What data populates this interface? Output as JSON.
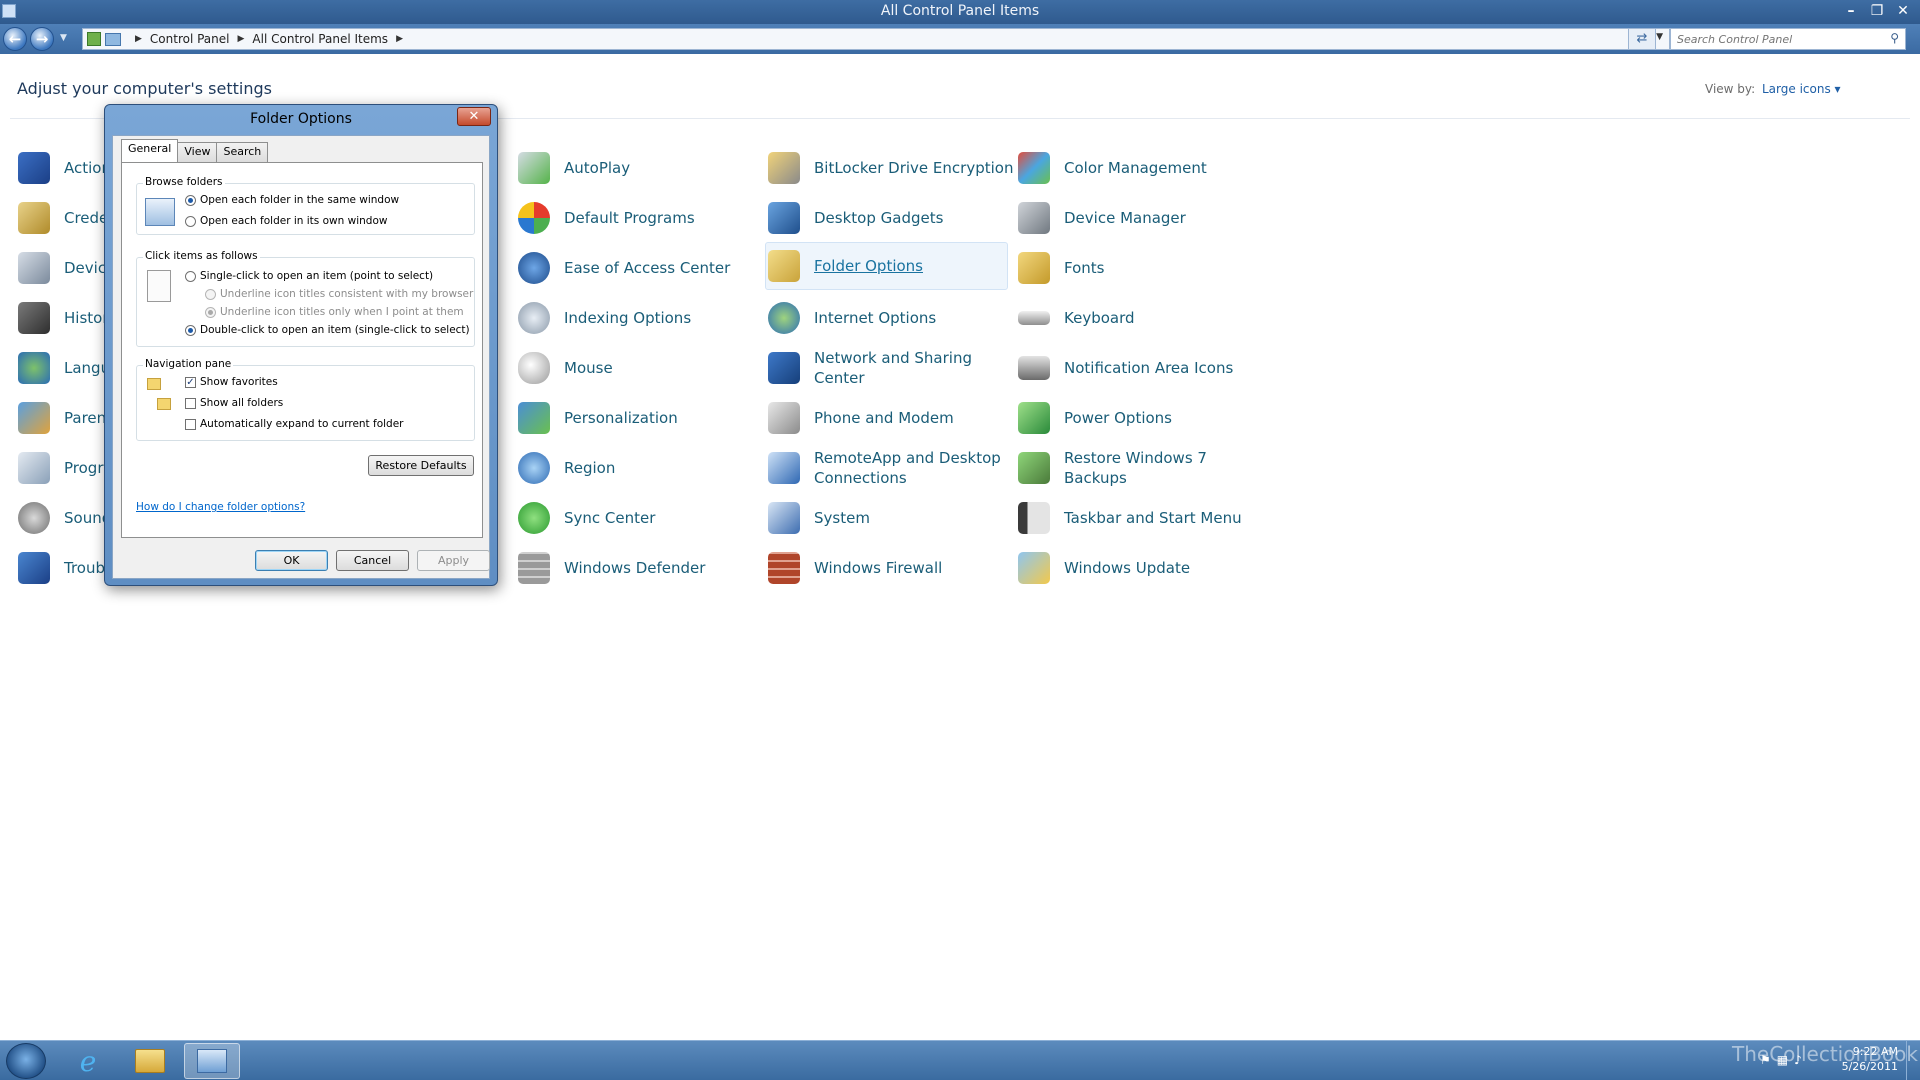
{
  "window": {
    "title": "All Control Panel Items"
  },
  "address": {
    "crumbs": [
      "Control Panel",
      "All Control Panel Items"
    ],
    "search_placeholder": "Search Control Panel"
  },
  "header": {
    "adjust": "Adjust your computer's settings",
    "view_by_label": "View by:",
    "view_by_value": "Large icons"
  },
  "items": {
    "col0": [
      "Action",
      "Crede",
      "Device",
      "Histor",
      "Langu",
      "Parent",
      "Progr",
      "Sound",
      "Troub"
    ],
    "col1": [
      "AutoPlay",
      "Default Programs",
      "Ease of Access Center",
      "Indexing Options",
      "Mouse",
      "Personalization",
      "Region",
      "Sync Center",
      "Windows Defender"
    ],
    "col2": [
      "BitLocker Drive Encryption",
      "Desktop Gadgets",
      "Folder Options",
      "Internet Options",
      "Network and Sharing Center",
      "Phone and Modem",
      "RemoteApp and Desktop Connections",
      "System",
      "Windows Firewall"
    ],
    "col3": [
      "Color Management",
      "Device Manager",
      "Fonts",
      "Keyboard",
      "Notification Area Icons",
      "Power Options",
      "Restore Windows 7 Backups",
      "Taskbar and Start Menu",
      "Windows Update"
    ]
  },
  "dialog": {
    "title": "Folder Options",
    "tabs": [
      "General",
      "View",
      "Search"
    ],
    "browse": {
      "title": "Browse folders",
      "opt1": "Open each folder in the same window",
      "opt2": "Open each folder in its own window"
    },
    "click": {
      "title": "Click items as follows",
      "single": "Single-click to open an item (point to select)",
      "under1": "Underline icon titles consistent with my browser",
      "under2": "Underline icon titles only when I point at them",
      "double": "Double-click to open an item (single-click to select)"
    },
    "nav": {
      "title": "Navigation pane",
      "fav": "Show favorites",
      "all": "Show all folders",
      "expand": "Automatically expand to current folder"
    },
    "restore": "Restore Defaults",
    "help_link": "How do I change folder options?",
    "ok": "OK",
    "cancel": "Cancel",
    "apply": "Apply"
  },
  "taskbar": {
    "watermark": "TheCollectionBook",
    "time": "9:22 AM",
    "date": "5/26/2011"
  }
}
